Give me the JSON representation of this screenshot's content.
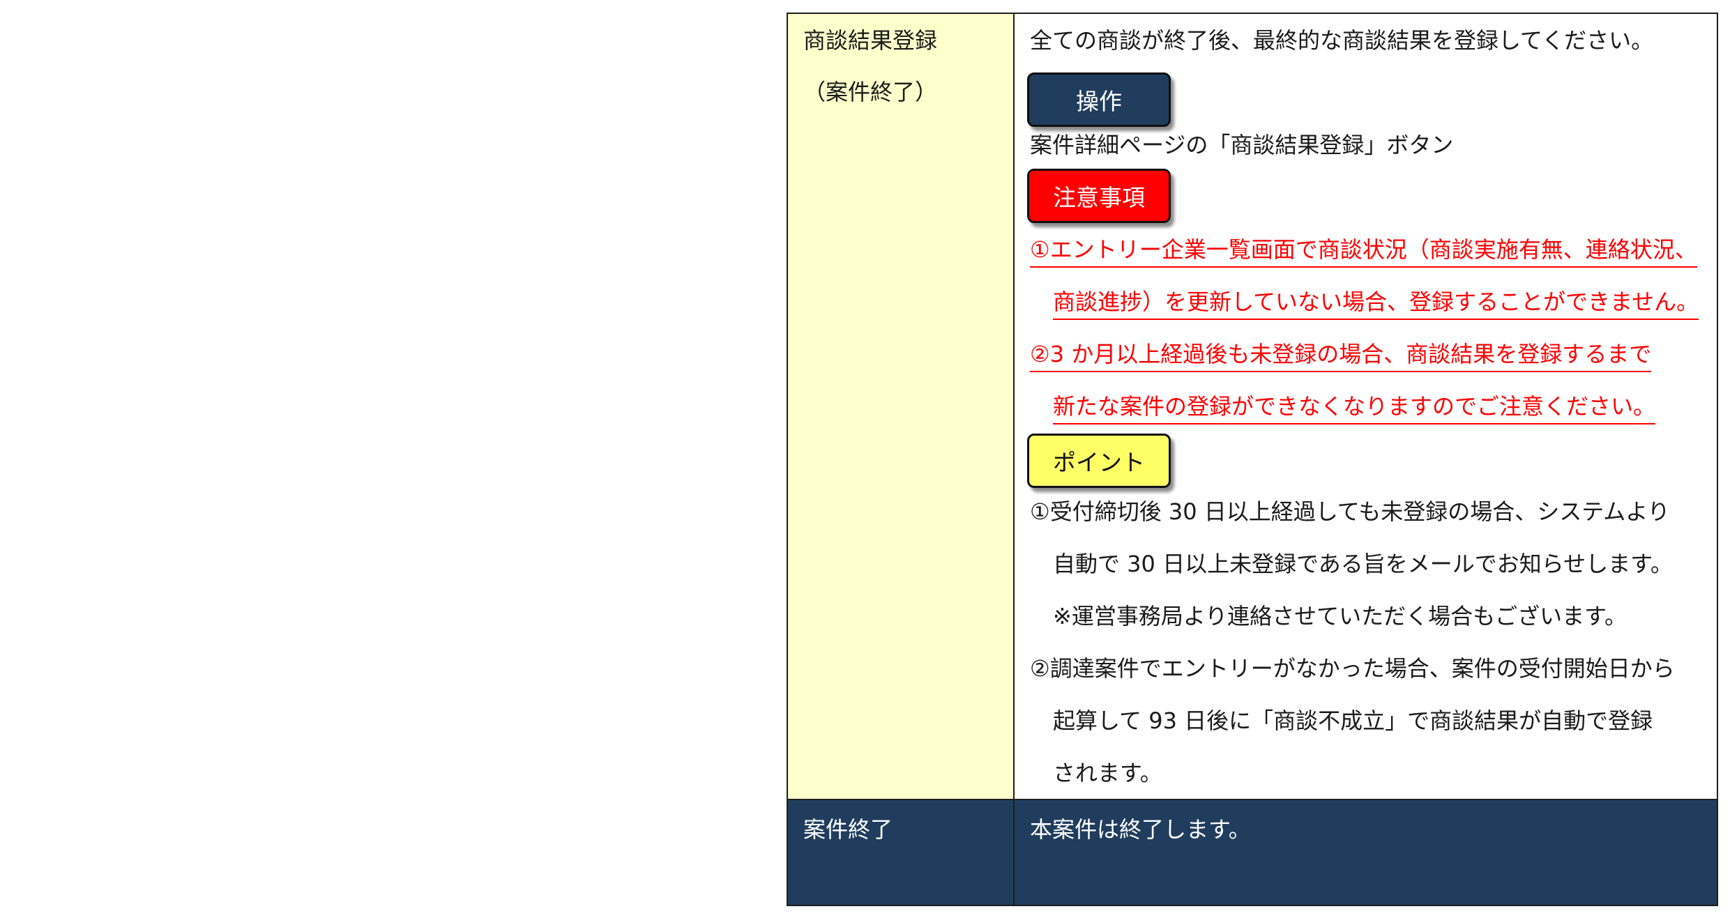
{
  "row1": {
    "label_line1": "商談結果登録",
    "label_line2": "（案件終了）",
    "intro": "全ての商談が終了後、最終的な商談結果を登録してください。",
    "operation_badge": "操作",
    "operation_text": "案件詳細ページの「商談結果登録」ボタン",
    "caution_badge": "注意事項",
    "caution_lines": [
      "①エントリー企業一覧画面で商談状況（商談実施有無、連絡状況、",
      "商談進捗）を更新していない場合、登録することができません。",
      "②3 か月以上経過後も未登録の場合、商談結果を登録するまで",
      "新たな案件の登録ができなくなりますのでご注意ください。"
    ],
    "point_badge": "ポイント",
    "point_lines": [
      "①受付締切後 30 日以上経過しても未登録の場合、システムより",
      "自動で 30 日以上未登録である旨をメールでお知らせします。",
      "※運営事務局より連絡させていただく場合もございます。",
      "②調達案件でエントリーがなかった場合、案件の受付開始日から",
      "起算して 93 日後に「商談不成立」で商談結果が自動で登録",
      "されます。"
    ]
  },
  "row2": {
    "label": "案件終了",
    "text": "本案件は終了します。"
  },
  "colors": {
    "dark_navy": "#213d5d",
    "label_bg": "#ffffcc",
    "caution_red": "#ff0000",
    "point_yellow": "#ffff66"
  }
}
